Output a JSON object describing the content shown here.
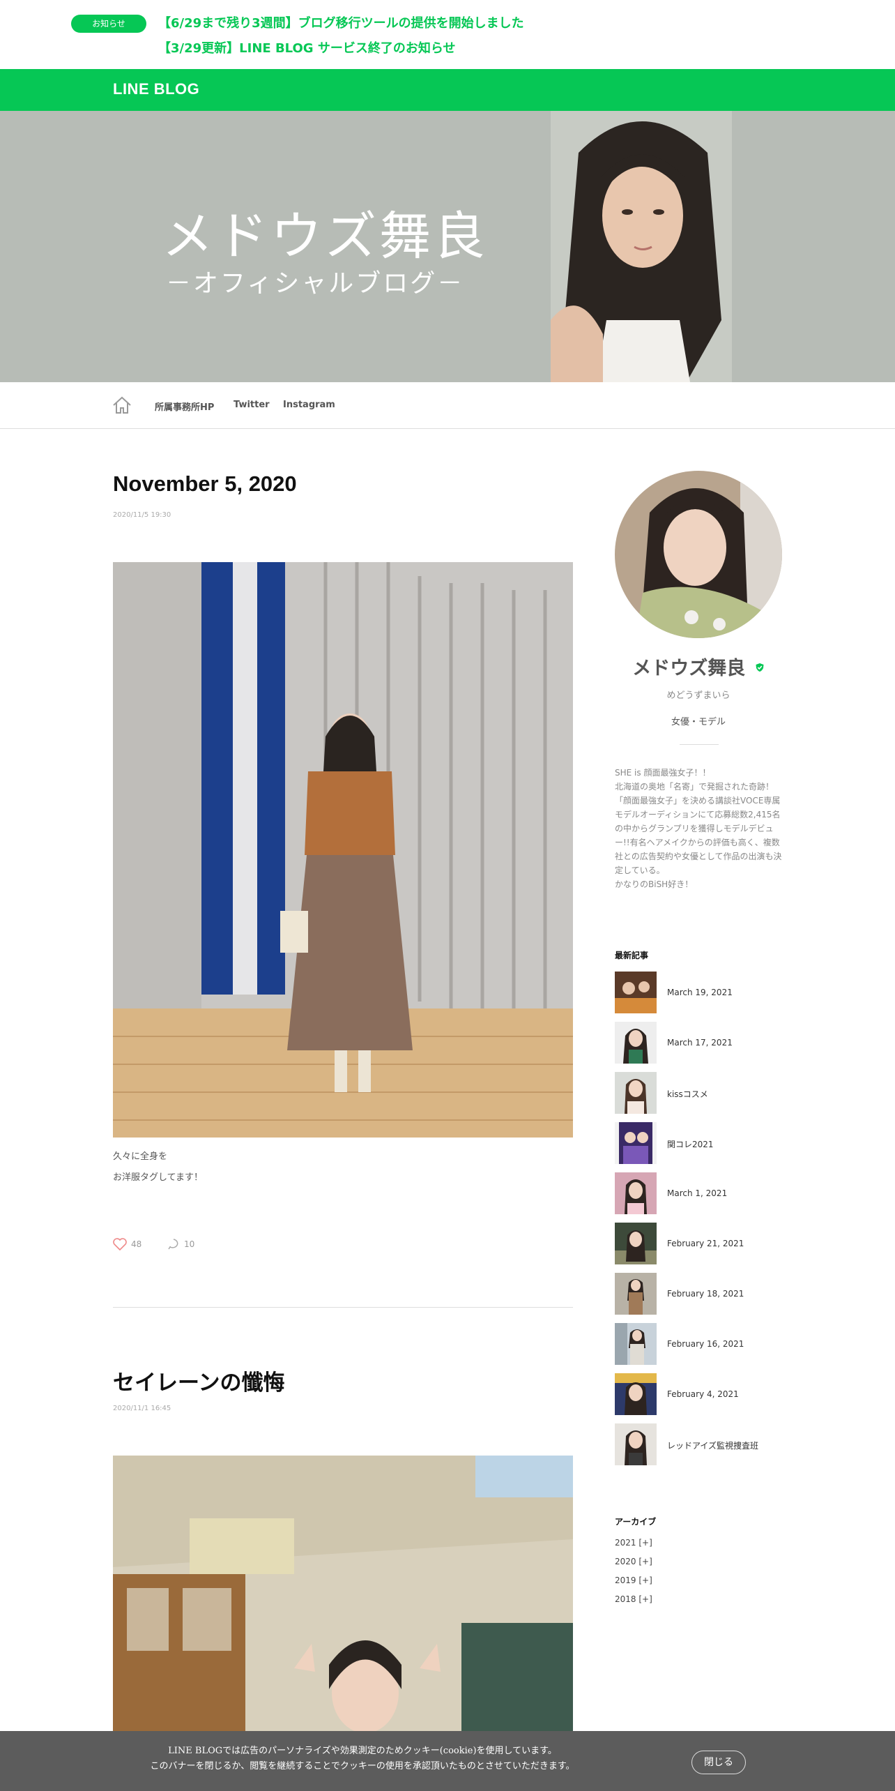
{
  "notice": {
    "badge": "お知らせ",
    "links": [
      "【6/29まで残り3週間】ブログ移行ツールの提供を開始しました",
      "【3/29更新】LINE BLOG サービス終了のお知らせ"
    ]
  },
  "header": {
    "logo": "LINE BLOG"
  },
  "hero": {
    "title": "メドウズ舞良",
    "subtitle": "－オフィシャルブログ－"
  },
  "nav": {
    "items": [
      "所属事務所HP",
      "Twitter",
      "Instagram"
    ]
  },
  "posts": [
    {
      "title": "November 5, 2020",
      "date": "2020/11/5 19:30",
      "body": [
        "久々に全身を",
        "お洋服タグしてます！"
      ],
      "likes": "48",
      "comments": "10"
    },
    {
      "title": "セイレーンの懺悔",
      "date": "2020/11/1 16:45"
    }
  ],
  "profile": {
    "name": "メドウズ舞良",
    "kana": "めどうずまいら",
    "role": "女優・モデル",
    "bio": "SHE is 顔面最強女子！！\n北海道の奥地「名寄」で発掘された奇跡！「顔面最強女子」を決める講談社VOCE専属モデルオーディションにて応募総数2,415名の中からグランプリを獲得しモデルデビュー!!有名ヘアメイクからの評価も高く、複数社との広告契約や女優として作品の出演も決定している。\nかなりのBiSH好き！"
  },
  "recent": {
    "heading": "最新記事",
    "items": [
      "March 19, 2021",
      "March 17, 2021",
      "kissコスメ",
      "関コレ2021",
      "March 1, 2021",
      "February 21, 2021",
      "February 18, 2021",
      "February 16, 2021",
      "February 4, 2021",
      "レッドアイズ監視捜査班"
    ]
  },
  "archive": {
    "heading": "アーカイブ",
    "items": [
      "2021 [+]",
      "2020 [+]",
      "2019 [+]",
      "2018 [+]"
    ]
  },
  "cookie": {
    "line1": "LINE BLOGでは広告のパーソナライズや効果測定のためクッキー(cookie)を使用しています。",
    "line2": "このバナーを閉じるか、閲覧を継続することでクッキーの使用を承認頂いたものとさせていただきます。",
    "close": "閉じる"
  },
  "colors": {
    "brand": "#06c755",
    "hero_bg": "#b7bcb6"
  },
  "icons": [
    "home-icon",
    "heart-icon",
    "comment-icon",
    "verified-icon"
  ]
}
